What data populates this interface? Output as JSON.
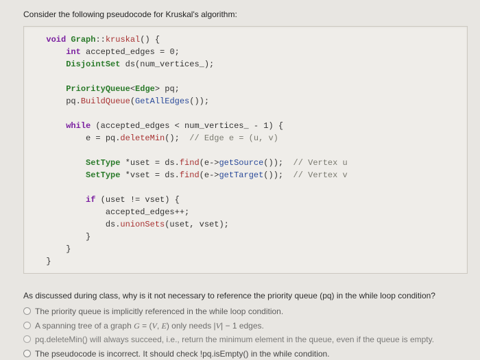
{
  "intro": "Consider the following pseudocode for Kruskal's algorithm:",
  "code": {
    "l1_a": "void",
    "l1_b": "Graph",
    "l1_c": "::",
    "l1_d": "kruskal",
    "l1_e": "() {",
    "l2_a": "int",
    "l2_b": " accepted_edges = 0;",
    "l3_a": "DisjointSet",
    "l3_b": " ds(num_vertices_);",
    "l5_a": "PriorityQueue",
    "l5_b": "<",
    "l5_c": "Edge",
    "l5_d": "> pq;",
    "l6_a": "      pq.",
    "l6_b": "BuildQueue",
    "l6_c": "(",
    "l6_d": "GetAllEdges",
    "l6_e": "());",
    "l8_a": "while",
    "l8_b": " (accepted_edges < num_vertices_ - 1) {",
    "l9_a": "          e = pq.",
    "l9_b": "deleteMin",
    "l9_c": "();  ",
    "l9_d": "// Edge e = (u, v)",
    "l11_a": "SetType",
    "l11_b": " *uset = ds.",
    "l11_c": "find",
    "l11_d": "(e->",
    "l11_e": "getSource",
    "l11_f": "());  ",
    "l11_g": "// Vertex u",
    "l12_a": "SetType",
    "l12_b": " *vset = ds.",
    "l12_c": "find",
    "l12_d": "(e->",
    "l12_e": "getTarget",
    "l12_f": "());  ",
    "l12_g": "// Vertex v",
    "l14_a": "if",
    "l14_b": " (uset != vset) {",
    "l15": "              accepted_edges++;",
    "l16_a": "              ds.",
    "l16_b": "unionSets",
    "l16_c": "(uset, vset);",
    "l17": "          }",
    "l18": "      }",
    "l19": "  }"
  },
  "question": "As discussed during class, why is it not necessary to reference the priority queue (pq) in the while loop condition?",
  "options": [
    "The priority queue is implicitly referenced in the while loop condition.",
    "|V| − 1",
    "pq.deleteMin() will always succeed, i.e., return the minimum element in the queue, even if the queue is empty.",
    "The pseudocode is incorrect. It should check !pq.isEmpty() in the while condition."
  ],
  "opt2_pre": "A spanning tree of a graph ",
  "opt2_mid": " only needs ",
  "opt2_post": " edges.",
  "opt2_G": "G",
  "opt2_eq": " = ",
  "opt2_paren_l": "(",
  "opt2_V": "V",
  "opt2_comma": ", ",
  "opt2_E": "E",
  "opt2_paren_r": ")",
  "opt2_abs_l": "|",
  "opt2_absV": "V",
  "opt2_abs_r": "|",
  "opt2_minus": " − 1"
}
